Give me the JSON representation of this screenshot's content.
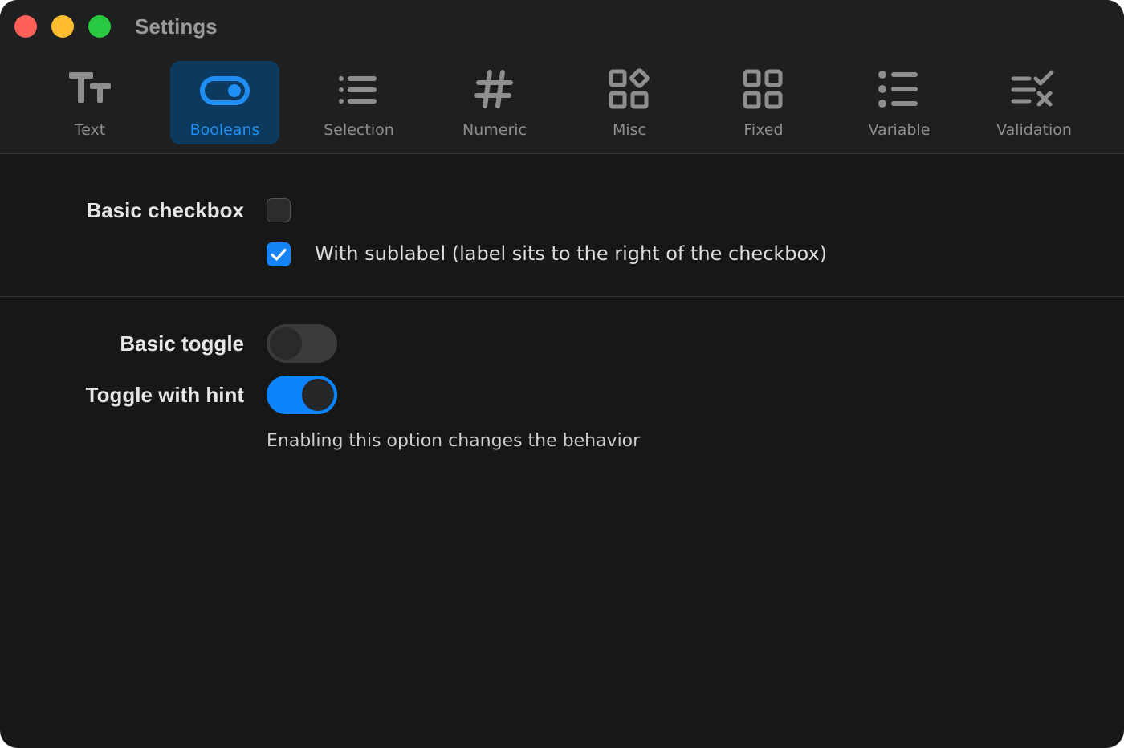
{
  "window": {
    "title": "Settings"
  },
  "toolbar": {
    "tabs": [
      {
        "label": "Text",
        "icon": "text-size-icon",
        "active": false
      },
      {
        "label": "Booleans",
        "icon": "toggle-icon",
        "active": true
      },
      {
        "label": "Selection",
        "icon": "list-icon",
        "active": false
      },
      {
        "label": "Numeric",
        "icon": "hashtag-icon",
        "active": false
      },
      {
        "label": "Misc",
        "icon": "shapes-grid-icon",
        "active": false
      },
      {
        "label": "Fixed",
        "icon": "grid-icon",
        "active": false
      },
      {
        "label": "Variable",
        "icon": "bulleted-list-icon",
        "active": false
      },
      {
        "label": "Validation",
        "icon": "check-x-list-icon",
        "active": false
      }
    ]
  },
  "checkbox_section": {
    "label": "Basic checkbox",
    "basic_checked": false,
    "sublabel": "With sublabel (label sits to the right of the checkbox)",
    "sublabel_checked": true
  },
  "toggle_section": {
    "basic_label": "Basic toggle",
    "basic_on": false,
    "hint_label": "Toggle with hint",
    "hint_on": true,
    "hint_text": "Enabling this option changes the behavior"
  },
  "colors": {
    "accent": "#0b84fe",
    "active_tab_bg": "#0c3a5f",
    "window_bg": "#171718",
    "toolbar_bg": "#1e1f20"
  }
}
